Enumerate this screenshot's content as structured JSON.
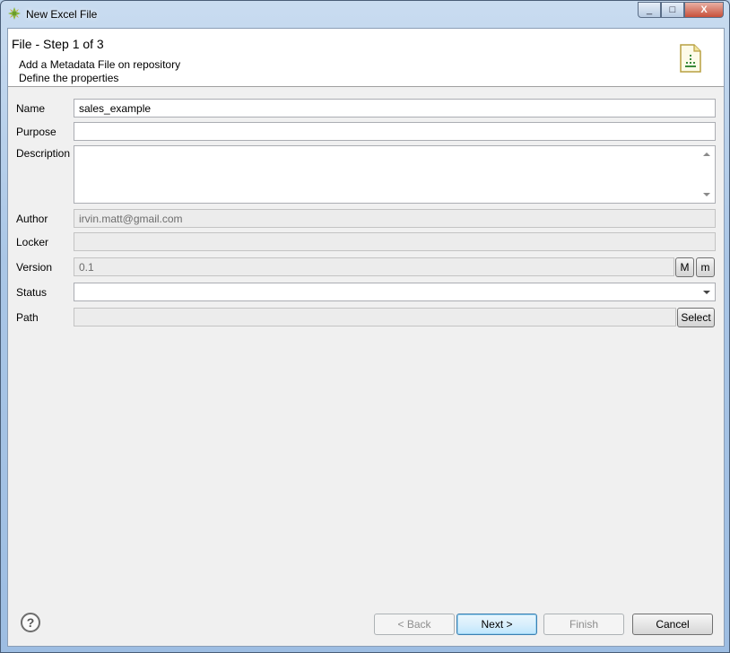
{
  "window": {
    "title": "New Excel File",
    "minimize": "_",
    "maximize": "□",
    "close": "X"
  },
  "header": {
    "step_title": "File - Step 1 of 3",
    "line1": "Add a Metadata File on repository",
    "line2": "Define the properties",
    "icon": "excel-file-icon"
  },
  "form": {
    "name_label": "Name",
    "name_value": "sales_example",
    "purpose_label": "Purpose",
    "purpose_value": "",
    "description_label": "Description",
    "description_value": "",
    "author_label": "Author",
    "author_value": "irvin.matt@gmail.com",
    "locker_label": "Locker",
    "locker_value": "",
    "version_label": "Version",
    "version_value": "0.1",
    "version_major_btn": "M",
    "version_minor_btn": "m",
    "status_label": "Status",
    "status_value": "",
    "path_label": "Path",
    "path_value": "",
    "path_select_btn": "Select"
  },
  "footer": {
    "help": "?",
    "back": "< Back",
    "next": "Next >",
    "finish": "Finish",
    "cancel": "Cancel"
  },
  "colors": {
    "titlebar": "#aac6e6",
    "dialog_bg": "#f0f0f0",
    "default_button_border": "#3c7fb1"
  }
}
